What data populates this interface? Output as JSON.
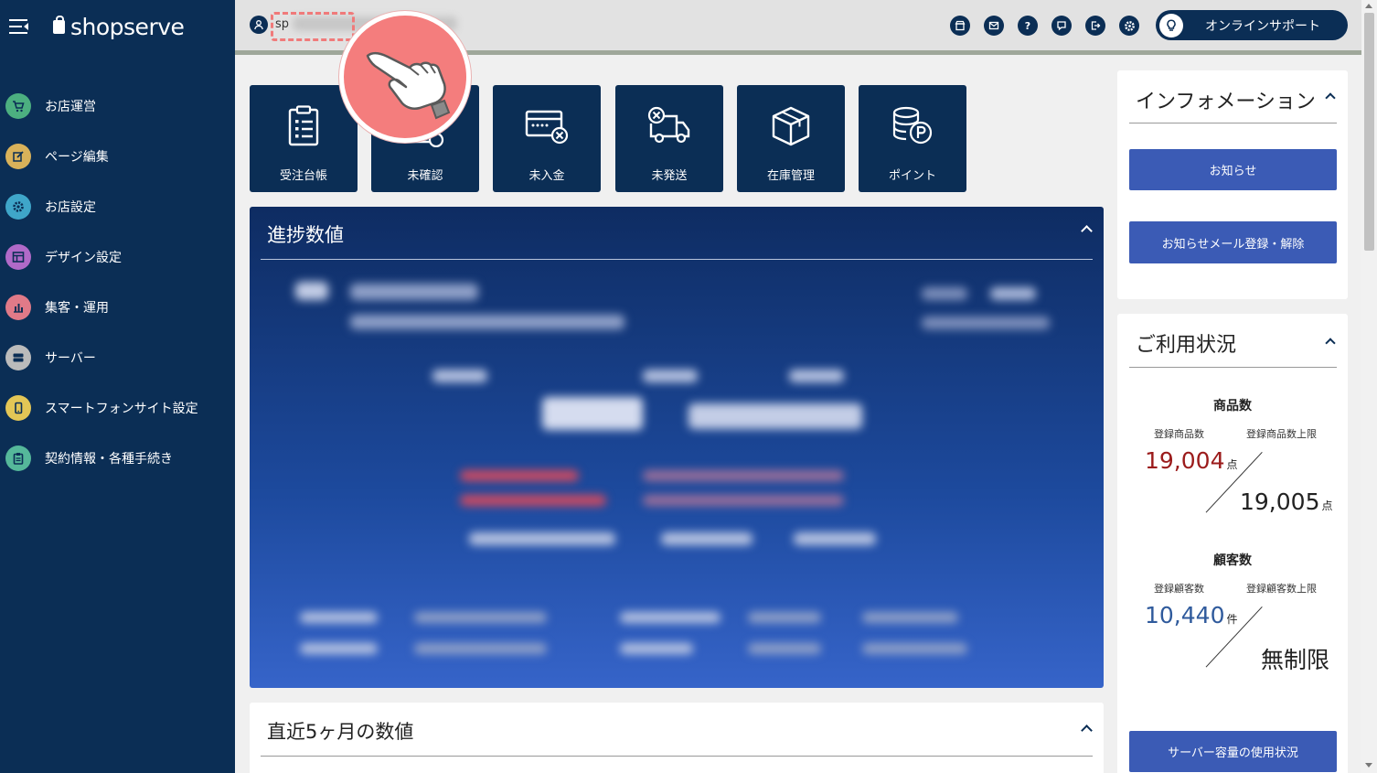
{
  "sidebar": {
    "brand": "shopserve",
    "items": [
      {
        "label": "お店運営",
        "icon": "cart-icon",
        "color": "#4caf80"
      },
      {
        "label": "ページ編集",
        "icon": "edit-icon",
        "color": "#d9b25a"
      },
      {
        "label": "お店設定",
        "icon": "gear-icon",
        "color": "#3fa6c9"
      },
      {
        "label": "デザイン設定",
        "icon": "layout-icon",
        "color": "#b06ac8"
      },
      {
        "label": "集客・運用",
        "icon": "chart-icon",
        "color": "#e07a88"
      },
      {
        "label": "サーバー",
        "icon": "server-icon",
        "color": "#bbbbbb"
      },
      {
        "label": "スマートフォンサイト設定",
        "icon": "smartphone-icon",
        "color": "#e3c656"
      },
      {
        "label": "契約情報・各種手続き",
        "icon": "clipboard-icon",
        "color": "#55b89a"
      }
    ]
  },
  "header": {
    "user_name": "sp",
    "support_label": "オンラインサポート",
    "tool_icons": [
      "store-icon",
      "mail-icon",
      "help-icon",
      "chat-icon",
      "logout-icon",
      "settings-icon"
    ]
  },
  "tiles": [
    {
      "label": "受注台帳",
      "icon": "order-ledger-icon"
    },
    {
      "label": "未確認",
      "icon": "unconfirmed-icon"
    },
    {
      "label": "未入金",
      "icon": "unpaid-icon"
    },
    {
      "label": "未発送",
      "icon": "unshipped-icon"
    },
    {
      "label": "在庫管理",
      "icon": "inventory-icon"
    },
    {
      "label": "ポイント",
      "icon": "points-icon"
    }
  ],
  "progress": {
    "title": "進捗数値"
  },
  "recent": {
    "title": "直近5ヶ月の数値"
  },
  "information": {
    "title": "インフォメーション",
    "buttons": [
      "お知らせ",
      "お知らせメール登録・解除"
    ]
  },
  "usage": {
    "title": "ご利用状況",
    "products": {
      "heading": "商品数",
      "registered_label": "登録商品数",
      "limit_label": "登録商品数上限",
      "registered": "19,004",
      "limit": "19,005",
      "unit": "点"
    },
    "customers": {
      "heading": "顧客数",
      "registered_label": "登録顧客数",
      "limit_label": "登録顧客数上限",
      "registered": "10,440",
      "limit": "無制限",
      "unit": "件"
    },
    "server_button": "サーバー容量の使用状況"
  },
  "colors": {
    "navy": "#0b2e55",
    "button_blue": "#3b5bb5",
    "product_count_red": "#9b1b1b",
    "customer_count_blue": "#2f5a9c",
    "pointer_pink": "#f47d7d"
  }
}
